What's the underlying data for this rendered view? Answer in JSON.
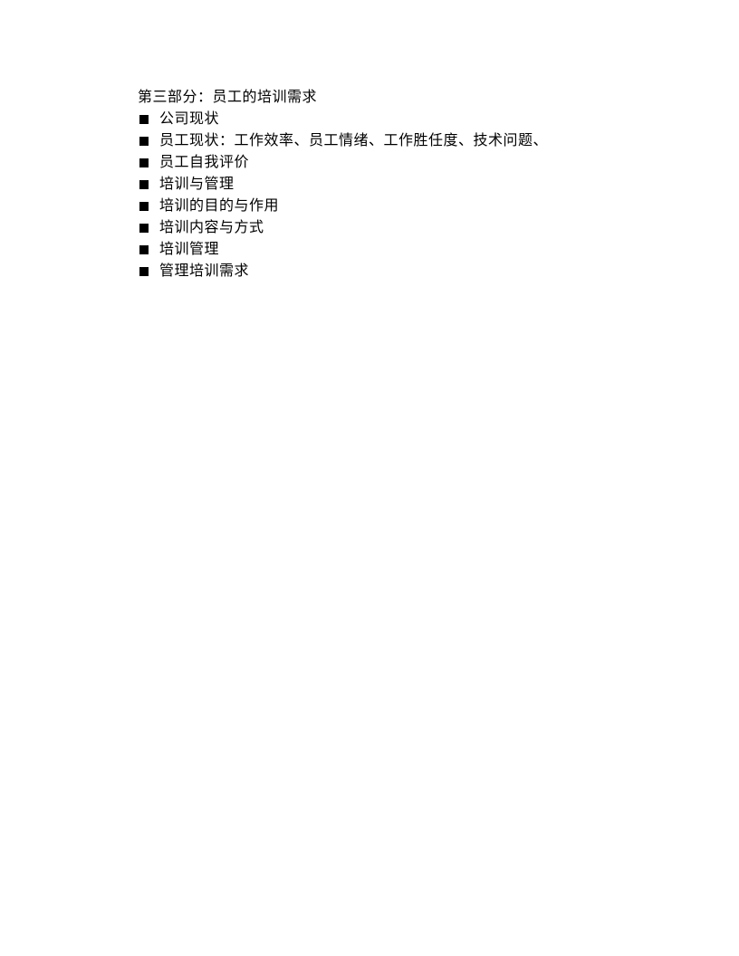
{
  "heading": "第三部分：员工的培训需求",
  "items": [
    "公司现状",
    "员工现状：工作效率、员工情绪、工作胜任度、技术问题、",
    "员工自我评价",
    "培训与管理",
    "培训的目的与作用",
    "培训内容与方式",
    "培训管理",
    "管理培训需求"
  ]
}
